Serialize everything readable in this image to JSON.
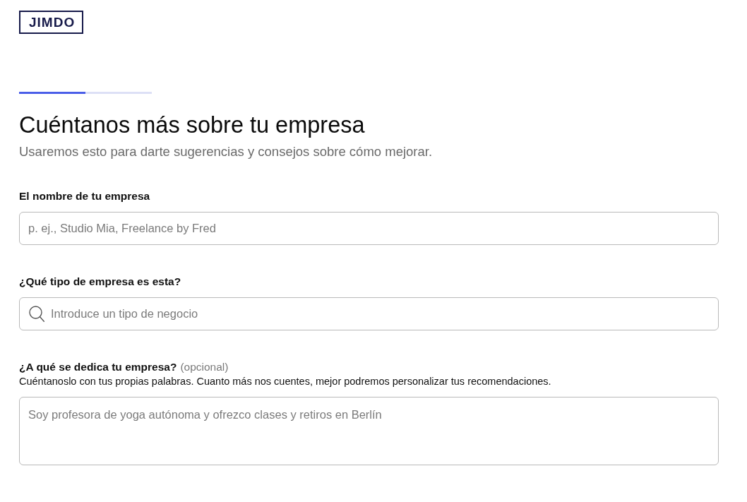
{
  "logo": {
    "text": "JIMDO"
  },
  "progress": {
    "level": 0.5
  },
  "heading": "Cuéntanos más sobre tu empresa",
  "subtitle": "Usaremos esto para darte sugerencias y consejos sobre cómo mejorar.",
  "fields": [
    {
      "kind": "text",
      "label": "El nombre de tu empresa",
      "placeholder": "p. ej., Studio Mia, Freelance by Fred"
    },
    {
      "kind": "search",
      "label": "¿Qué tipo de empresa es esta?",
      "placeholder": "Introduce un tipo de negocio"
    },
    {
      "kind": "textarea",
      "label": "¿A qué se dedica tu empresa?",
      "optional_note": "(opcional)",
      "help": "Cuéntanoslo con tus propias palabras. Cuanto más nos cuentes, mejor podremos personalizar tus recomendaciones.",
      "placeholder": "Soy profesora de yoga autónoma y ofrezco clases y retiros en Berlín"
    }
  ]
}
